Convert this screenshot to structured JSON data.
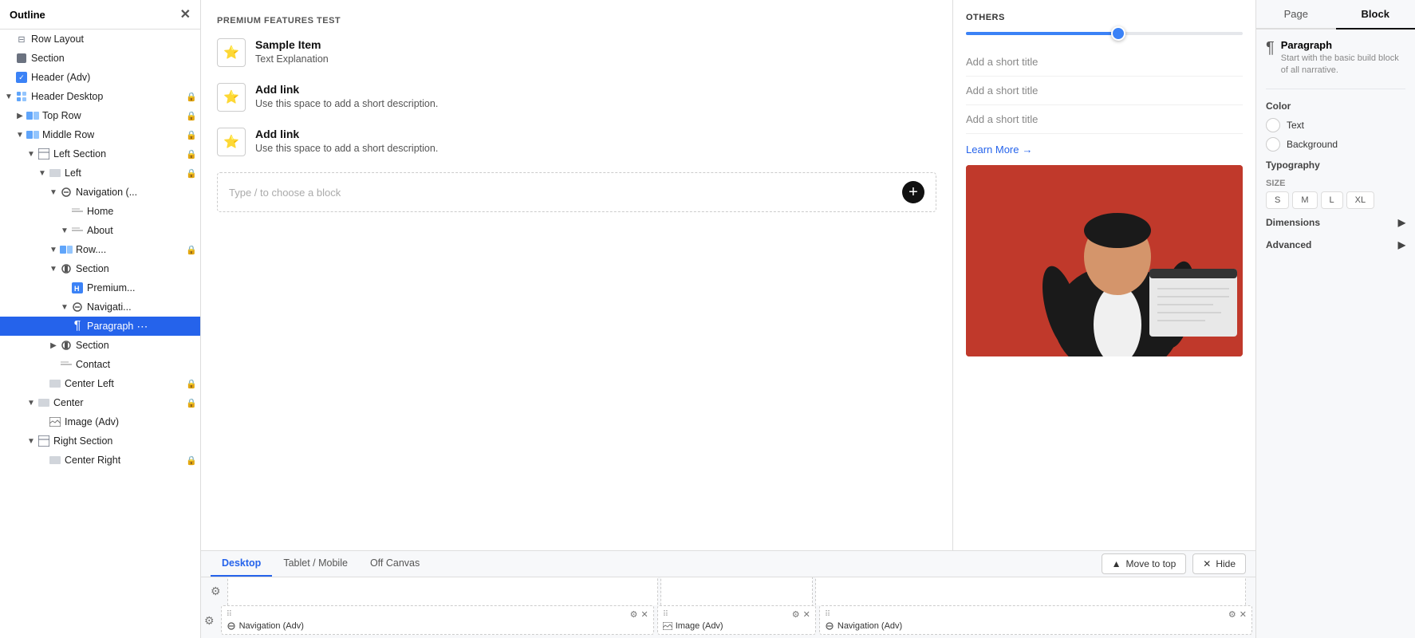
{
  "sidebar": {
    "title": "Outline",
    "items": [
      {
        "id": "row-layout",
        "label": "Row Layout",
        "depth": 0,
        "icon": "row",
        "hasChevron": false,
        "locked": false
      },
      {
        "id": "section",
        "label": "Section",
        "depth": 0,
        "icon": "section",
        "hasChevron": false,
        "locked": false
      },
      {
        "id": "header-adv",
        "label": "Header (Adv)",
        "depth": 0,
        "icon": "check",
        "hasChevron": false,
        "locked": false
      },
      {
        "id": "header-desktop",
        "label": "Header Desktop",
        "depth": 1,
        "icon": "grid",
        "hasChevron": true,
        "locked": true
      },
      {
        "id": "top-row",
        "label": "Top Row",
        "depth": 2,
        "icon": "row",
        "hasChevron": true,
        "locked": true
      },
      {
        "id": "middle-row",
        "label": "Middle Row",
        "depth": 2,
        "icon": "row",
        "hasChevron": true,
        "locked": true
      },
      {
        "id": "left-section",
        "label": "Left Section",
        "depth": 3,
        "icon": "section-small",
        "hasChevron": true,
        "locked": true
      },
      {
        "id": "left",
        "label": "Left",
        "depth": 4,
        "icon": "center",
        "hasChevron": true,
        "locked": true
      },
      {
        "id": "navigation",
        "label": "Navigation (...",
        "depth": 5,
        "icon": "nav",
        "hasChevron": true,
        "locked": false
      },
      {
        "id": "home",
        "label": "Home",
        "depth": 6,
        "icon": "nav-item",
        "hasChevron": false,
        "locked": false
      },
      {
        "id": "about",
        "label": "About",
        "depth": 6,
        "icon": "nav-item",
        "hasChevron": true,
        "locked": false
      },
      {
        "id": "row-dots",
        "label": "Row....",
        "depth": 5,
        "icon": "row",
        "hasChevron": true,
        "locked": true
      },
      {
        "id": "section2",
        "label": "Section",
        "depth": 5,
        "icon": "section-ctrl",
        "hasChevron": true,
        "locked": false
      },
      {
        "id": "premium",
        "label": "Premium...",
        "depth": 6,
        "icon": "header-h",
        "hasChevron": false,
        "locked": false
      },
      {
        "id": "navigati",
        "label": "Navigati...",
        "depth": 6,
        "icon": "nav",
        "hasChevron": true,
        "locked": false
      },
      {
        "id": "paragraph",
        "label": "Paragraph",
        "depth": 6,
        "icon": "paragraph",
        "hasChevron": false,
        "locked": false,
        "active": true
      },
      {
        "id": "section3",
        "label": "Section",
        "depth": 5,
        "icon": "section-ctrl",
        "hasChevron": true,
        "locked": false
      },
      {
        "id": "contact",
        "label": "Contact",
        "depth": 5,
        "icon": "nav-item",
        "hasChevron": false,
        "locked": false
      },
      {
        "id": "center-left",
        "label": "Center Left",
        "depth": 4,
        "icon": "center",
        "hasChevron": false,
        "locked": true
      },
      {
        "id": "center",
        "label": "Center",
        "depth": 3,
        "icon": "center",
        "hasChevron": true,
        "locked": true
      },
      {
        "id": "image-adv",
        "label": "Image (Adv)",
        "depth": 4,
        "icon": "image",
        "hasChevron": false,
        "locked": false
      },
      {
        "id": "right-section",
        "label": "Right Section",
        "depth": 3,
        "icon": "section-small",
        "hasChevron": true,
        "locked": false
      },
      {
        "id": "center-right",
        "label": "Center Right",
        "depth": 4,
        "icon": "center",
        "hasChevron": false,
        "locked": true
      }
    ]
  },
  "canvas": {
    "section_label": "PREMIUM FEATURES TEST",
    "features": [
      {
        "title": "Sample Item",
        "desc": "Text Explanation"
      },
      {
        "title": "Add link",
        "desc": "Use this space to add a short description."
      },
      {
        "title": "Add link",
        "desc": "Use this space to add a short description."
      }
    ],
    "type_placeholder": "Type / to choose a block"
  },
  "others": {
    "title": "OTHERS",
    "slider_pct": 55,
    "titles": [
      "Add a short title",
      "Add a short title",
      "Add a short title"
    ],
    "learn_more": "Learn More",
    "learn_more_arrow": "→"
  },
  "props": {
    "tab_page": "Page",
    "tab_block": "Block",
    "active_tab": "block",
    "block_type": "Paragraph",
    "block_desc": "Start with the basic build block of all narrative.",
    "color_section": "Color",
    "color_text": "Text",
    "color_background": "Background",
    "typography_section": "Typography",
    "size_section": "SIZE",
    "sizes": [
      "S",
      "M",
      "L",
      "XL"
    ],
    "dimensions_section": "Dimensions",
    "advanced_section": "Advanced"
  },
  "bottom": {
    "tab_desktop": "Desktop",
    "tab_tablet": "Tablet / Mobile",
    "tab_offcanvas": "Off Canvas",
    "active_tab": "desktop",
    "move_to_top": "Move to top",
    "hide": "Hide",
    "cells": [
      {
        "label": "Navigation (Adv)",
        "icon": "nav"
      },
      {
        "label": "Image (Adv)",
        "icon": "image"
      },
      {
        "label": "Navigation (Adv)",
        "icon": "nav"
      }
    ]
  }
}
